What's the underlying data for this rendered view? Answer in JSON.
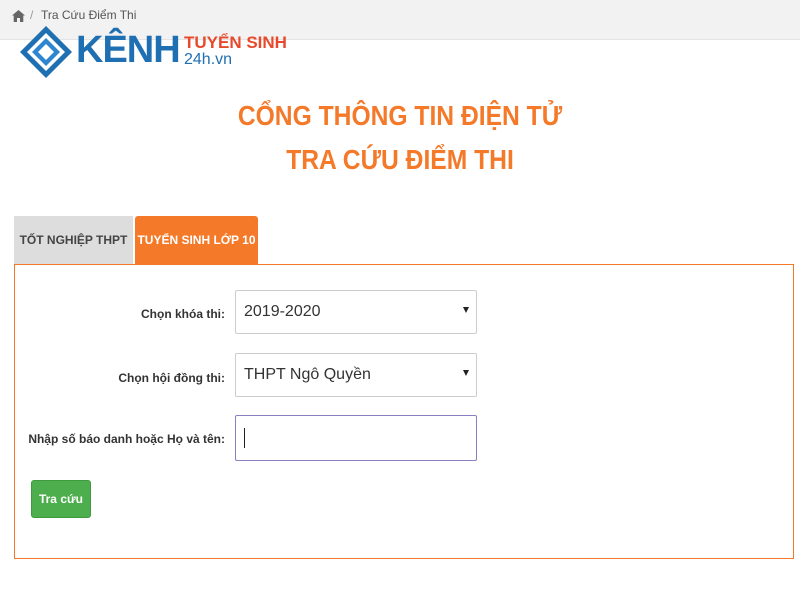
{
  "breadcrumb": {
    "home_icon": "home-icon",
    "separator": "/",
    "current": "Tra Cứu Điểm Thi"
  },
  "logo": {
    "word_main": "KÊNH",
    "word_tuyen": "TUYỂN SINH",
    "word_domain": "24h.vn"
  },
  "header": {
    "title_line1": "CỔNG THÔNG TIN ĐIỆN TỬ",
    "title_line2": "TRA CỨU ĐIỂM THI"
  },
  "tabs": [
    {
      "label": "TỐT NGHIỆP THPT",
      "active": false
    },
    {
      "label": "TUYỂN SINH LỚP 10",
      "active": true
    }
  ],
  "form": {
    "exam_year_label": "Chọn khóa thi:",
    "exam_year_value": "2019-2020",
    "council_label": "Chọn hội đồng thi:",
    "council_value": "THPT Ngô Quyền",
    "search_label": "Nhập số báo danh hoặc Họ và tên:",
    "search_value": "",
    "submit_label": "Tra cứu"
  },
  "colors": {
    "accent": "#f47a2a",
    "button": "#4cae4c",
    "logo_blue": "#1f6fb3",
    "logo_red": "#e8492c"
  }
}
